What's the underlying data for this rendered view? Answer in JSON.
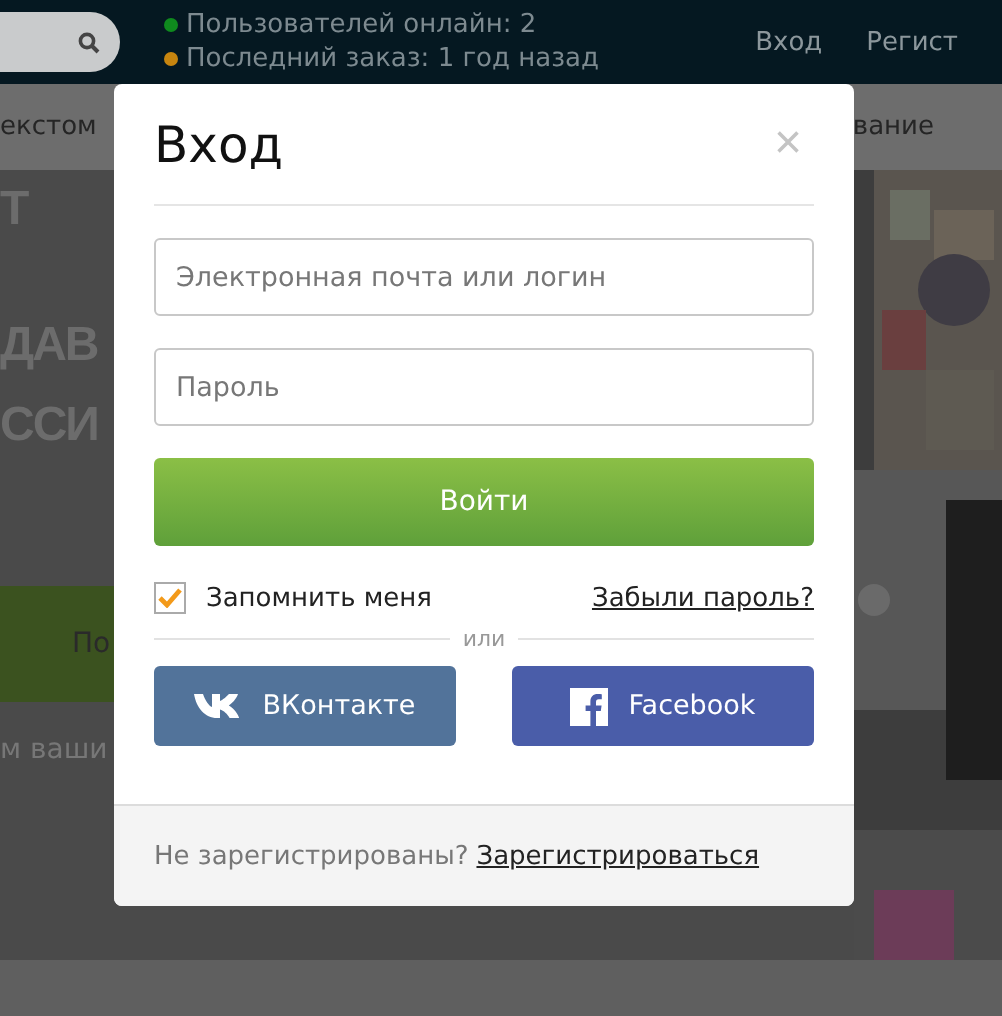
{
  "header": {
    "status": [
      {
        "text": "Пользователей онлайн: 2",
        "color": "#0f8a1e"
      },
      {
        "text": "Последний заказ: 1 год назад",
        "color": "#c7850f"
      }
    ],
    "links": [
      "Вход",
      "Регист"
    ]
  },
  "nav": [
    "екстом",
    "вание"
  ],
  "hero": {
    "lines": [
      "Т",
      "ДАВ",
      "ССИ"
    ],
    "button": "По",
    "tagline": "м ваши"
  },
  "modal": {
    "title": "Вход",
    "close": "×",
    "fields": [
      {
        "placeholder": "Электронная почта или логин"
      },
      {
        "placeholder": "Пароль"
      }
    ],
    "submit": "Войти",
    "remember": {
      "label": "Запомнить меня",
      "checked": true
    },
    "forgot": "Забыли пароль?",
    "divider": "или",
    "social": [
      {
        "kind": "vk",
        "label": "ВКонтакте"
      },
      {
        "kind": "facebook",
        "label": "Facebook"
      }
    ],
    "footer": {
      "text": "Не зарегистрированы?",
      "link": "Зарегистрироваться"
    }
  }
}
